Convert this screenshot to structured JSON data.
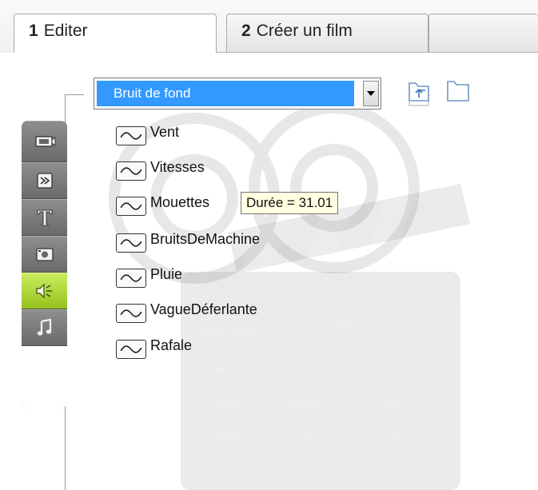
{
  "tabs": [
    {
      "number": "1",
      "label": "Editer",
      "active": true
    },
    {
      "number": "2",
      "label": "Créer un film",
      "active": false
    }
  ],
  "dropdown": {
    "selected": "Bruit de fond"
  },
  "toolbar_icons": [
    "video-icon",
    "transition-icon",
    "title-icon",
    "photo-icon",
    "audio-icon",
    "music-icon"
  ],
  "audio_items": [
    {
      "label": "Vent"
    },
    {
      "label": "Vitesses"
    },
    {
      "label": "Mouettes"
    },
    {
      "label": "BruitsDeMachine"
    },
    {
      "label": "Pluie"
    },
    {
      "label": "VagueDéferlante"
    },
    {
      "label": "Rafale"
    }
  ],
  "tooltip": "Durée = 31.01",
  "watermark": {
    "production": "My Movie",
    "director_label": "DIRECTOR",
    "director": "You",
    "camera_label": "CAMERA",
    "camera": "#074",
    "date_label": "DATE",
    "scene_label": "SCENE",
    "take_label": "TAKE",
    "date": "Today",
    "scene": "03",
    "take": "01"
  },
  "colors": {
    "dropdown_highlight": "#3399ff",
    "active_toolbar": "#a6d42a",
    "toolbar_gray": "#7c7c7c",
    "tooltip_bg": "#ffffe1"
  }
}
